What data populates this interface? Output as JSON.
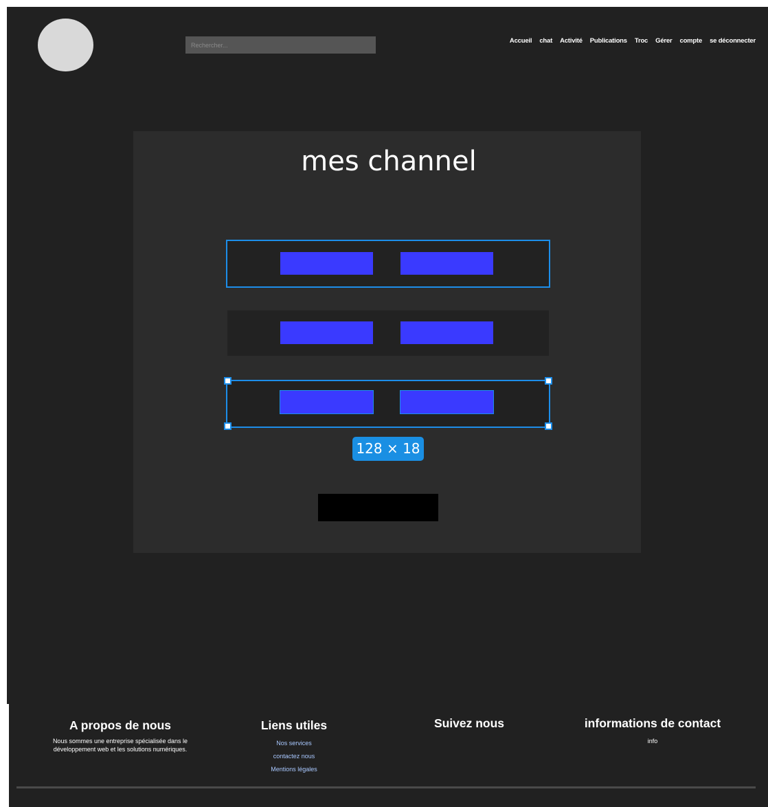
{
  "header": {
    "search_placeholder": "Rechercher...",
    "nav": [
      "Accueil",
      "chat",
      "Activité",
      "Publications",
      "Troc",
      "Gérer",
      "compte",
      "se déconnecter"
    ]
  },
  "main": {
    "title": "mes channel",
    "size_label": "128 × 18"
  },
  "footer": {
    "about": {
      "title": "A propos de nous",
      "text": "Nous sommes une entreprise spécialisée dans le développement web et les solutions numériques."
    },
    "links": {
      "title": "Liens utiles",
      "items": [
        "Nos services",
        "contactez nous",
        "Mentions légales"
      ]
    },
    "follow": {
      "title": "Suivez nous"
    },
    "contact": {
      "title": "informations de contact",
      "text": "info"
    }
  },
  "colors": {
    "background": "#212121",
    "panel": "#2c2c2c",
    "button": "#3a3aff",
    "selection": "#1d8eea"
  }
}
